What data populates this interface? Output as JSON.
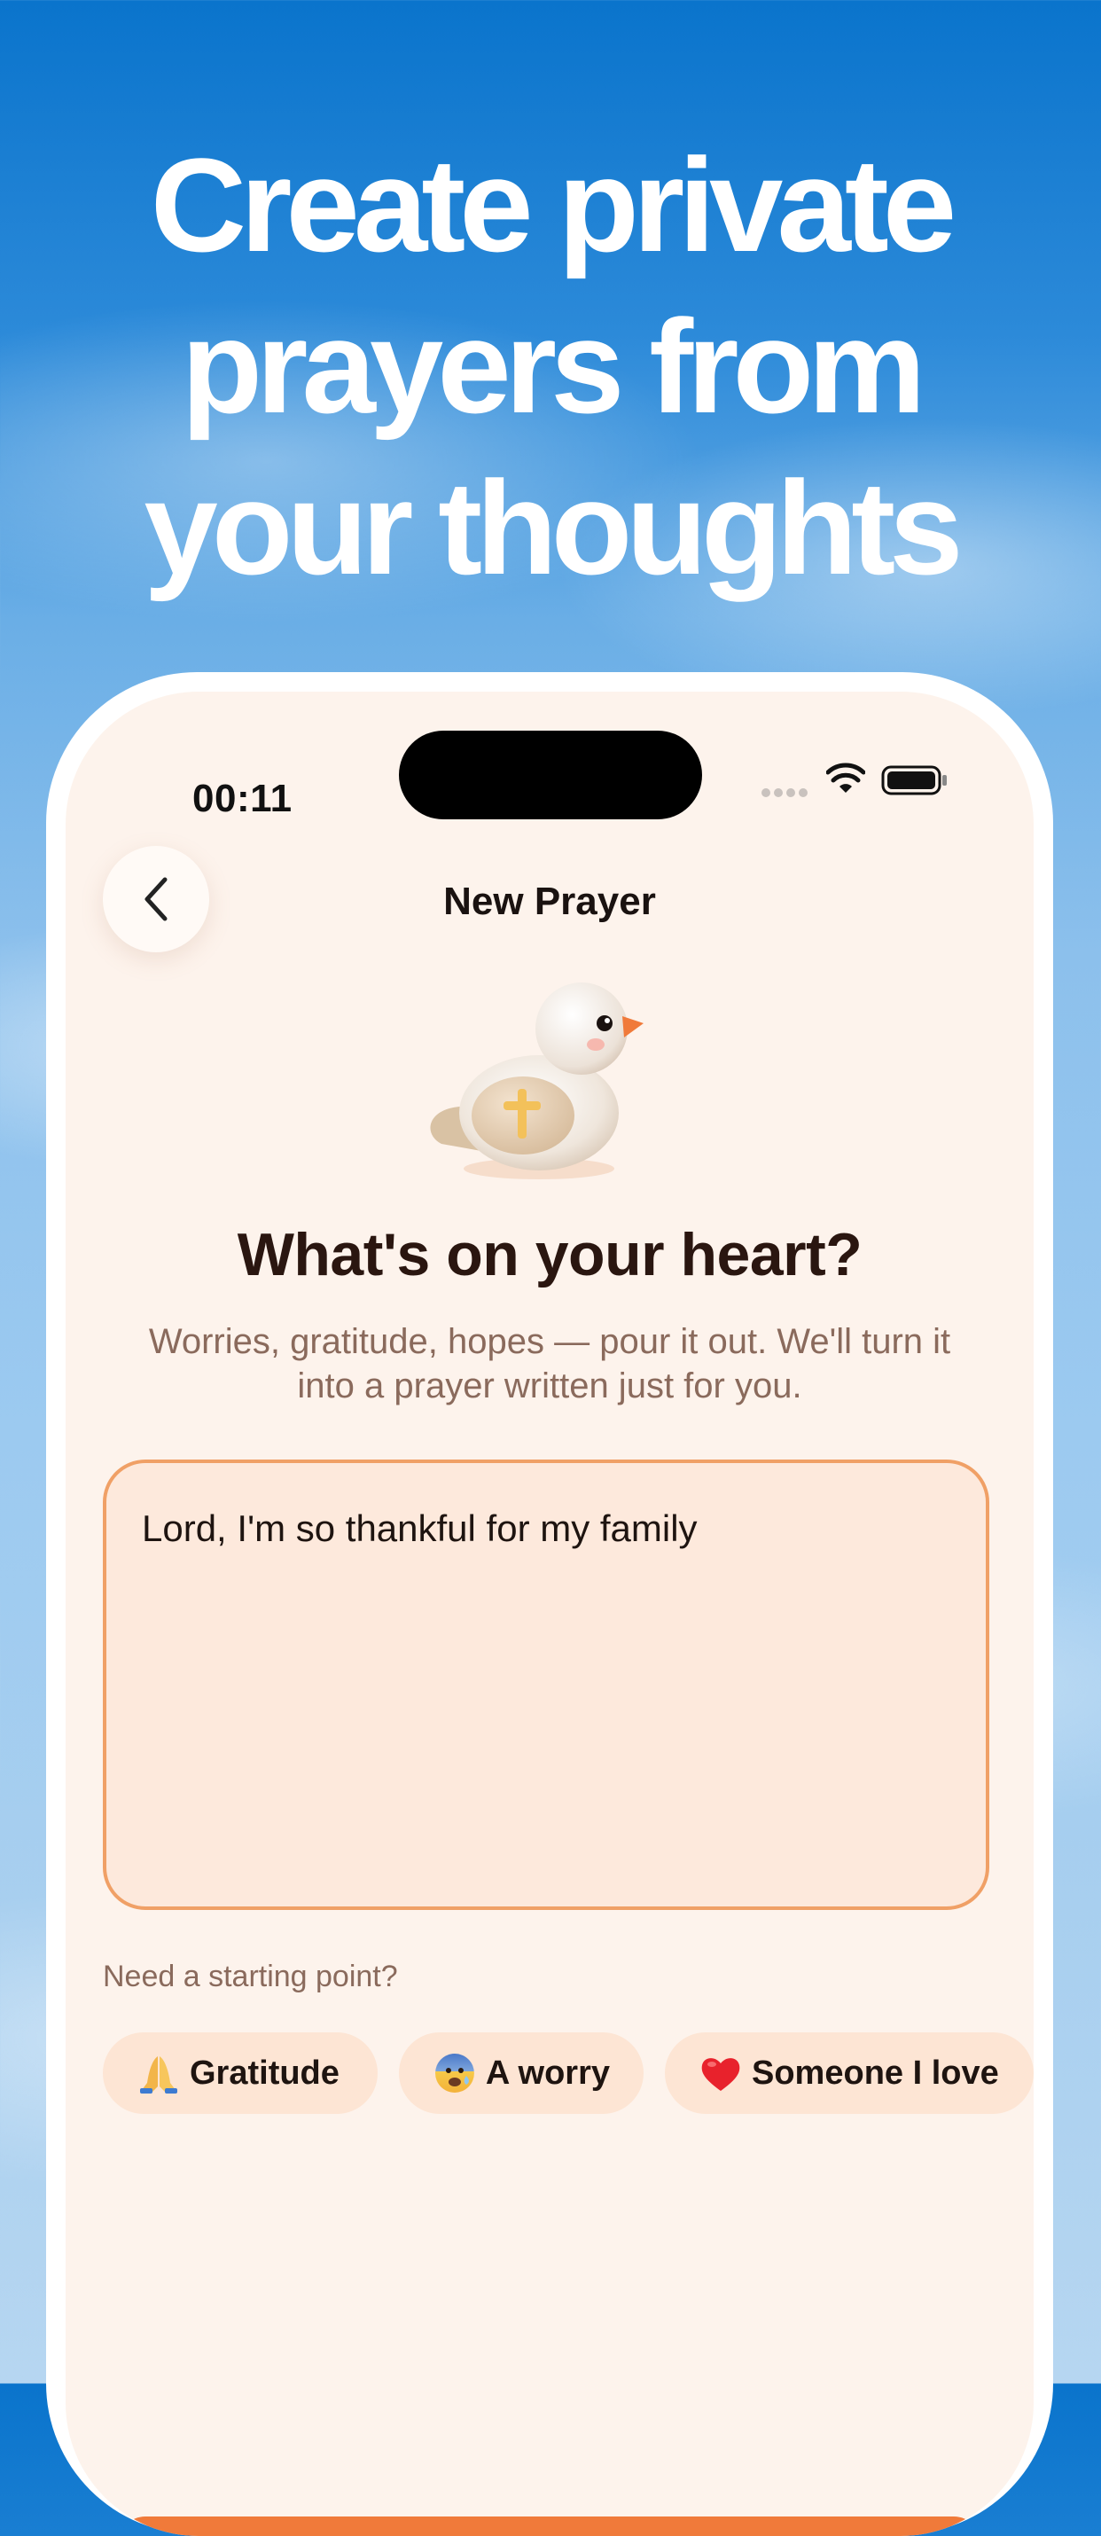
{
  "headline": {
    "line1": "Create private",
    "line2": "prayers from",
    "line3": "your thoughts"
  },
  "status_bar": {
    "time": "00:11"
  },
  "nav": {
    "title": "New Prayer"
  },
  "prompt": {
    "question": "What's on your heart?",
    "subtitle": "Worries, gratitude, hopes — pour it out. We'll turn it into a prayer written just for you."
  },
  "prayer_input": {
    "value": "Lord, I'm so thankful for my family"
  },
  "suggestions": {
    "hint": "Need a starting point?",
    "chips": [
      {
        "icon": "praying-hands-emoji",
        "label": "Gratitude"
      },
      {
        "icon": "anxious-face-emoji",
        "label": "A worry"
      },
      {
        "icon": "red-heart-emoji",
        "label": "Someone I love"
      }
    ]
  },
  "colors": {
    "accent": "#f0a066",
    "screen_background": "#fdf3ec",
    "chip_background": "#fde5d4",
    "cta": "#f07a3a"
  }
}
